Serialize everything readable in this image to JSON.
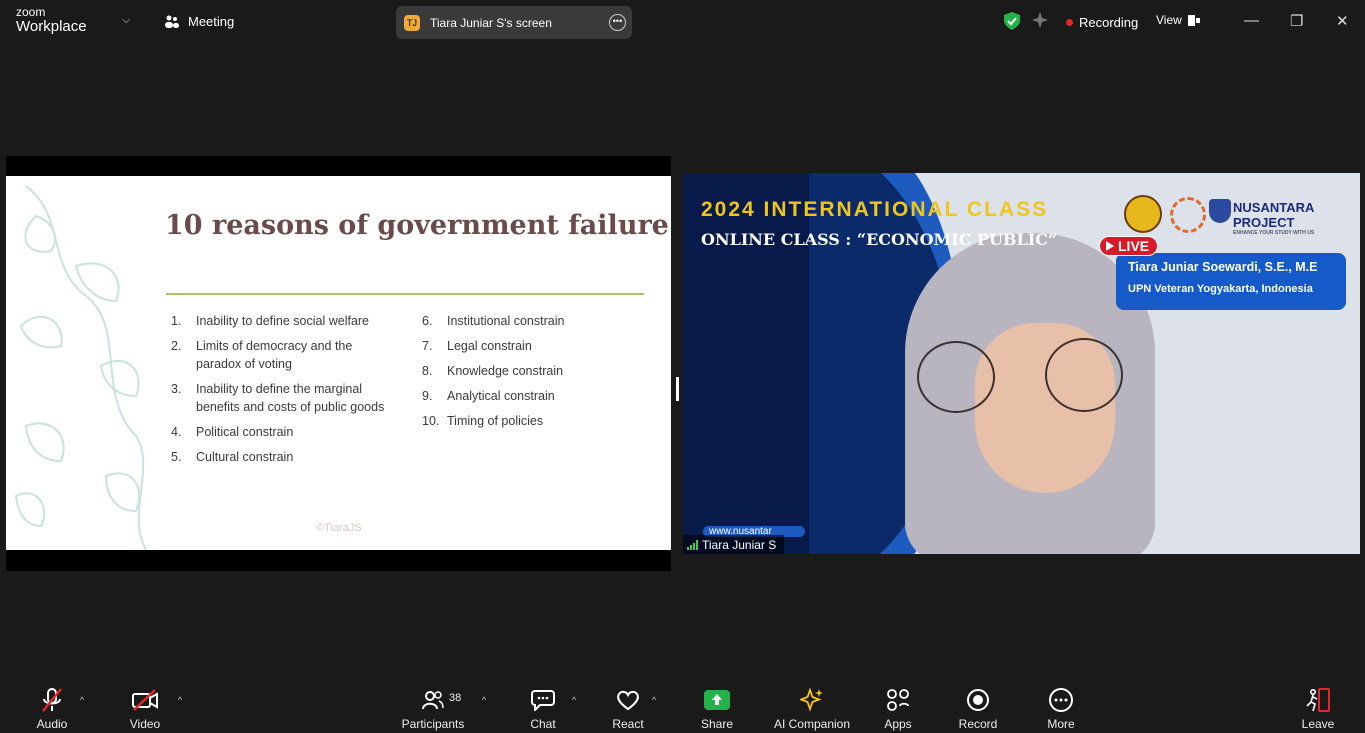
{
  "app": {
    "brand_small": "zoom",
    "brand_large": "Workplace",
    "meeting_label": "Meeting"
  },
  "screen_share": {
    "avatar_initials": "TJ",
    "label": "Tiara Juniar S's screen"
  },
  "status": {
    "recording": "Recording",
    "view": "View"
  },
  "slide": {
    "title": "10 reasons of government failure",
    "left_items": [
      {
        "n": "1.",
        "t": "Inability to define social welfare"
      },
      {
        "n": "2.",
        "t": "Limits of democracy and the paradox of voting"
      },
      {
        "n": "3.",
        "t": "Inability to define the marginal benefits and costs of public goods"
      },
      {
        "n": "4.",
        "t": "Political constrain"
      },
      {
        "n": "5.",
        "t": "Cultural constrain"
      }
    ],
    "right_items": [
      {
        "n": "6.",
        "t": "Institutional constrain"
      },
      {
        "n": "7.",
        "t": "Legal constrain"
      },
      {
        "n": "8.",
        "t": "Knowledge constrain"
      },
      {
        "n": "9.",
        "t": "Analytical constrain"
      },
      {
        "n": "10.",
        "t": "Timing of policies"
      }
    ],
    "copyright": "©TiaraJS",
    "accent_color": "#a8c26a",
    "title_color": "#6a4a4a"
  },
  "video": {
    "banner_1": "2024 INTERNATIONAL CLASS",
    "banner_2": "ONLINE CLASS : “ECONOMIC PUBLIC”",
    "live": "LIVE",
    "presenter_name": "Tiara Juniar Soewardi, S.E., M.E",
    "presenter_affiliation": "UPN Veteran Yogyakarta, Indonesia",
    "project_name": "NUSANTARA PROJECT",
    "project_tagline": "ENHANCE YOUR STUDY WITH US",
    "url": "www.nusantar",
    "participant_name": "Tiara Juniar S"
  },
  "toolbar": {
    "audio": "Audio",
    "video": "Video",
    "participants": "Participants",
    "participants_count": "38",
    "chat": "Chat",
    "react": "React",
    "share": "Share",
    "ai_companion": "AI Companion",
    "apps": "Apps",
    "record": "Record",
    "more": "More",
    "leave": "Leave"
  }
}
